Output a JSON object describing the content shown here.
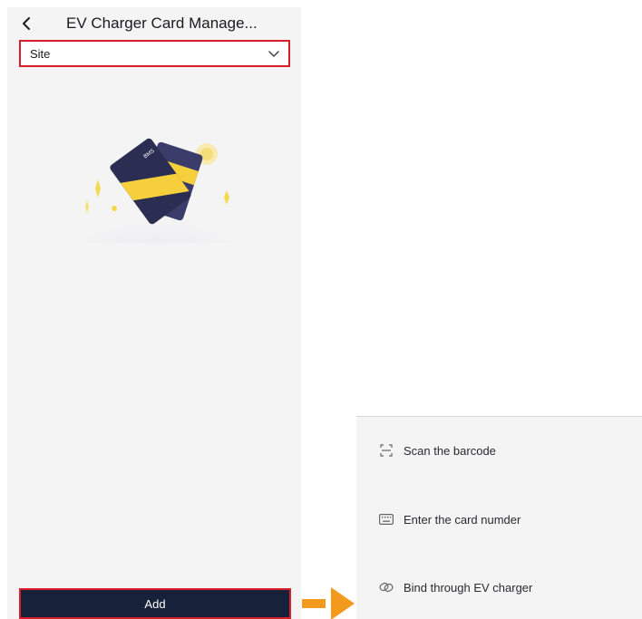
{
  "header": {
    "back_icon": "chevron-left-icon",
    "title": "EV Charger Card Manage..."
  },
  "site_selector": {
    "value": "Site",
    "chevron_icon": "chevron-down-icon"
  },
  "illustration": {
    "icon": "card-illustration",
    "card_text": "BMS"
  },
  "footer": {
    "add_label": "Add"
  },
  "action_sheet": {
    "items": [
      {
        "label": "Scan the barcode",
        "icon": "scan-icon"
      },
      {
        "label": "Enter the card numder",
        "icon": "keyboard-icon"
      },
      {
        "label": "Bind through EV charger",
        "icon": "link-icon"
      }
    ]
  },
  "colors": {
    "highlight": "#d81e2a",
    "primary_button": "#17213a",
    "arrow": "#f39a1e",
    "card_yellow": "#f5cf3c",
    "card_navy": "#2b2d52"
  }
}
